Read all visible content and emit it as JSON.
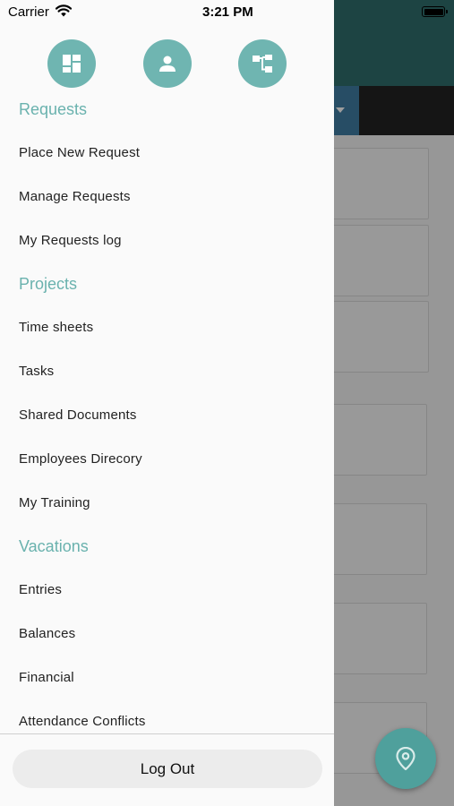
{
  "status_bar": {
    "carrier": "Carrier",
    "time": "3:21 PM",
    "wifi_icon": "wifi-icon",
    "battery_icon": "battery-icon"
  },
  "drawer": {
    "top_buttons": [
      {
        "name": "dashboard-icon"
      },
      {
        "name": "profile-icon"
      },
      {
        "name": "org-chart-icon"
      }
    ],
    "sections": [
      {
        "title": "Requests",
        "items": [
          "Place New Request",
          "Manage Requests",
          "My Requests log"
        ]
      },
      {
        "title": "Projects",
        "items": [
          "Time sheets",
          "Tasks",
          "Shared Documents",
          "Employees Direcory",
          "My Training"
        ]
      },
      {
        "title": "Vacations",
        "items": [
          "Entries",
          "Balances",
          "Financial",
          "Attendance Conflicts"
        ]
      }
    ],
    "logout_label": "Log Out"
  },
  "background": {
    "fab_icon": "location-pin-icon"
  },
  "colors": {
    "accent": "#6ab2ae",
    "header": "#2f6f6c",
    "fab": "#4fa09c"
  }
}
